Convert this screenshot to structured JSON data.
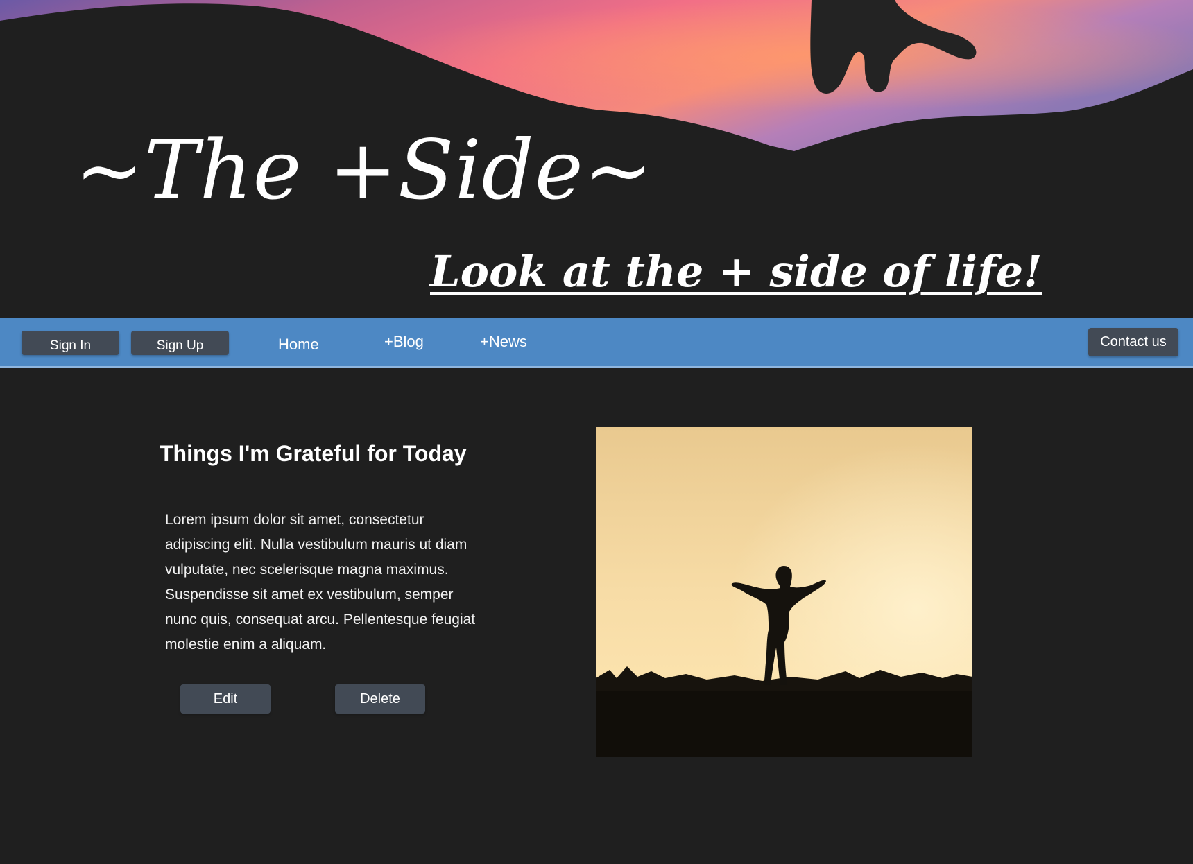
{
  "header": {
    "site_title": "~The +Side~",
    "tagline": "Look at the + side of life!"
  },
  "nav": {
    "sign_in": "Sign In",
    "sign_up": "Sign Up",
    "links": [
      "Home",
      "+Blog",
      "+News"
    ],
    "contact": "Contact us",
    "bar_color": "#4d88c4"
  },
  "post": {
    "title": "Things I'm Grateful for Today",
    "body": "Lorem ipsum dolor sit amet, consectetur adipiscing elit. Nulla vestibulum mauris ut diam vulputate, nec scelerisque magna maximus. Suspendisse sit amet ex vestibulum, semper nunc quis, consequat arcu. Pellentesque feugiat molestie enim a aliquam.",
    "edit_label": "Edit",
    "delete_label": "Delete",
    "image_icon": "person-silhouette-sunset-photo"
  },
  "colors": {
    "background": "#1f1f1f",
    "button": "#424a55",
    "sky_pink": "#f46a8a",
    "sky_purple": "#7a5ea8"
  }
}
